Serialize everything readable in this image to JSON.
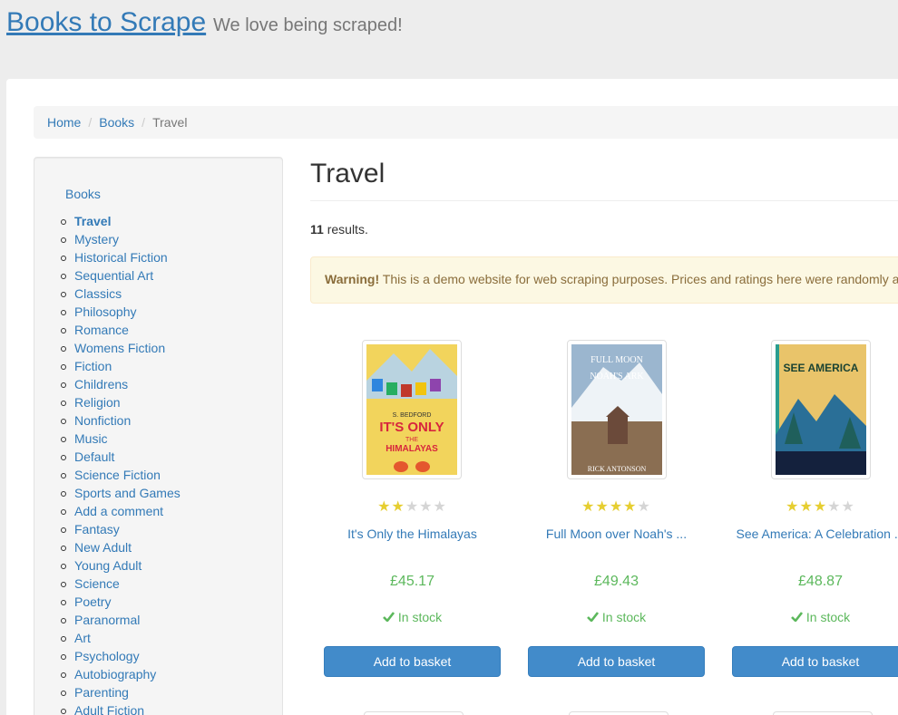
{
  "header": {
    "brand": "Books to Scrape",
    "tagline": "We love being scraped!"
  },
  "breadcrumb": [
    "Home",
    "Books",
    "Travel"
  ],
  "sidebar": {
    "title": "Books",
    "categories": [
      "Travel",
      "Mystery",
      "Historical Fiction",
      "Sequential Art",
      "Classics",
      "Philosophy",
      "Romance",
      "Womens Fiction",
      "Fiction",
      "Childrens",
      "Religion",
      "Nonfiction",
      "Music",
      "Default",
      "Science Fiction",
      "Sports and Games",
      "Add a comment",
      "Fantasy",
      "New Adult",
      "Young Adult",
      "Science",
      "Poetry",
      "Paranormal",
      "Art",
      "Psychology",
      "Autobiography",
      "Parenting",
      "Adult Fiction"
    ],
    "active": "Travel"
  },
  "main": {
    "title": "Travel",
    "results_count": "11",
    "results_suffix": "results.",
    "warning_strong": "Warning!",
    "warning_text": "This is a demo website for web scraping purposes. Prices and ratings here were randomly a"
  },
  "books": [
    {
      "title": "It's Only the Himalayas",
      "price": "£45.17",
      "rating": 2,
      "stock": "In stock",
      "button": "Add to basket",
      "cover": {
        "bg": "#f2d45c",
        "accent": "#e4572e",
        "text": "#d7263d",
        "lines": [
          "S. BEDFORD",
          "IT'S ONLY",
          "THE",
          "HIMALAYAS"
        ]
      }
    },
    {
      "title": "Full Moon over Noah's ...",
      "price": "£49.43",
      "rating": 4,
      "stock": "In stock",
      "button": "Add to basket",
      "cover": {
        "bg": "#9bb6cf",
        "accent": "#6b4a3a",
        "text": "#ffffff",
        "lines": [
          "FULL MOON",
          "NOAH'S ARK",
          "RICK ANTONSON"
        ]
      }
    },
    {
      "title": "See America: A Celebration ...",
      "price": "£48.87",
      "rating": 3,
      "stock": "In stock",
      "button": "Add to basket",
      "cover": {
        "bg": "#e9c46a",
        "accent": "#1f5f5b",
        "text": "#1b4332",
        "lines": [
          "SEE AMERICA"
        ]
      }
    }
  ],
  "colors": {
    "link": "#337ab7",
    "price": "#5cb85c",
    "star_on": "#e6ce31",
    "star_off": "#d5d5d5",
    "button": "#428bca",
    "warning_bg": "#fcf8e3"
  },
  "icons": {
    "star": "star-icon",
    "check": "check-icon"
  }
}
